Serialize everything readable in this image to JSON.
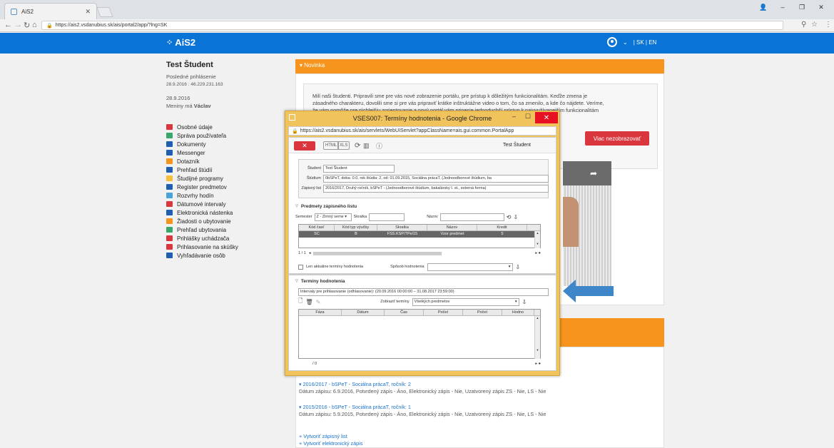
{
  "browser": {
    "tab_title": "AiS2",
    "url": "https://ais2.vsdanubius.sk/ais/portal2/app/?lng=SK"
  },
  "header": {
    "logo": "AiS2",
    "lang": "| SK | EN"
  },
  "user": {
    "name": "Test Študent",
    "last_login_label": "Posledné prihlásenie",
    "last_login": "28.9.2016 : 46.229.231.163",
    "date": "28.9.2016",
    "nameday_prefix": "Meniny má",
    "nameday": "Václav"
  },
  "menu": [
    {
      "label": "Osobné údaje",
      "color": "#d9363e"
    },
    {
      "label": "Správa používateľa",
      "color": "#3aa86a"
    },
    {
      "label": "Dokumenty",
      "color": "#1f5fb2"
    },
    {
      "label": "Messenger",
      "color": "#1f5fb2"
    },
    {
      "label": "Dotazník",
      "color": "#f7941d"
    },
    {
      "label": "Prehľad štúdií",
      "color": "#1f5fb2"
    },
    {
      "label": "Študijné programy",
      "color": "#f7c03c"
    },
    {
      "label": "Register predmetov",
      "color": "#1f5fb2"
    },
    {
      "label": "Rozvrhy hodín",
      "color": "#4aa3d8"
    },
    {
      "label": "Dátumové intervaly",
      "color": "#d9363e"
    },
    {
      "label": "Elektronická nástenka",
      "color": "#1f5fb2"
    },
    {
      "label": "Žiadosti o ubytovanie",
      "color": "#f7941d"
    },
    {
      "label": "Prehľad ubytovania",
      "color": "#3aa86a"
    },
    {
      "label": "Prihlášky uchádzača",
      "color": "#d9363e"
    },
    {
      "label": "Prihlasovanie na skúšky",
      "color": "#d9363e"
    },
    {
      "label": "Vyhľadávanie osôb",
      "color": "#1f5fb2"
    }
  ],
  "novinka": {
    "title": "▾ Novinka",
    "text1": "Milí naši študenti. Pripravili sme pre vás nové zobrazenie portálu, pre prístup k dôležitým funkcionalitám. Keďže zmena je",
    "text2": "zásadného charakteru, dovolili sme si pre vás pripraviť krátke inštruktážne video o tom, čo sa zmenilo, a kde čo nájdete. Veríme,",
    "text3": "že vám pomôže pre rýchlejšiu zorientovanie a nový portál vám prinesie jednoduchší prístup k najvyužívanejším funkcionalitám",
    "button": "Viac nezobrazovať"
  },
  "studia": [
    {
      "title": "▾ 2016/2017 - bSPeT - Sociálna prácaT, ročník: 2",
      "detail": "Dátum zápisu: 6.9.2016, Potvrdený zápis - Áno, Elektronický zápis - Nie, Uzatvorený zápis ZS - Nie, LS - Nie"
    },
    {
      "title": "▾ 2015/2016 - bSPeT - Sociálna prácaT, ročník: 1",
      "detail": "Dátum zápisu: 5.9.2015, Potvrdený zápis - Áno, Elektronický zápis - Nie, Uzatvorený zápis ZS - Nie, LS - Nie"
    }
  ],
  "links": {
    "l1": "+ Vytvoriť zápisný list",
    "l2": "+ Vytvoriť elektronický zápis"
  },
  "popup": {
    "title": "VSES007: Termíny hodnotenia - Google Chrome",
    "url": "https://ais2.vsdanubius.sk/ais/servlets/WebUIServlet?appClassName=ais.gui.common.PortalApp",
    "user": "Test Študent",
    "student_label": "Študent",
    "student": "Test Študent",
    "studium_label": "Štúdium",
    "studium": "0bSPeT, doba: 0.0, rok štúdia: 2, od: 01.09.2015, Sociálna prácaT, (Jednoodborové štúdium, ba",
    "zapisny_label": "Zápisný list",
    "zapisny": "2016/2017, Druhý ročník, bSPeT - (Jednoodborové štúdium, bakalársky I. st., externá forma)",
    "sect1": "Predmety zápisného listu",
    "semester_label": "Semester",
    "semester": "Z - Zimný seme",
    "skratka_label": "Skratka",
    "nazov_label": "Názov",
    "cols1": [
      "Kód časť",
      "Kód typ výučby",
      "Skratka",
      "Názov",
      "Kredit"
    ],
    "row1": [
      "SC",
      "B",
      "FSS.KSP/TPe/15",
      "Vzor predmet",
      "5"
    ],
    "pager1": "1   /   1",
    "aktualne": "Len aktuálne termíny hodnotenia",
    "sposob_label": "Spôsob hodnotenia",
    "sect2": "Termíny hodnotenia",
    "intervaly": "Intervaly pre prihlasovanie (odhlasovanie): (20.09.2016 00:00:00 – 31.08.2017 23:59:00)",
    "zobrazit_label": "Zobraziť termíny",
    "zobrazit": "Všetkých predmetov",
    "cols2": [
      "Fáza",
      "Dátum",
      "Čas",
      "Počet",
      "Počet",
      "Hodno"
    ],
    "pager2": "/   0"
  }
}
